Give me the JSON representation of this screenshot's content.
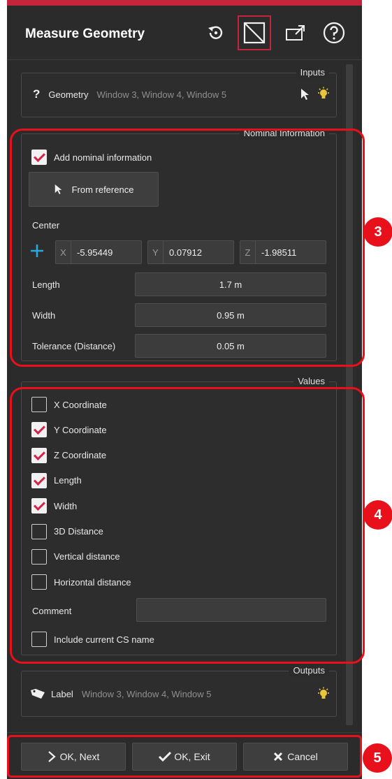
{
  "header": {
    "title": "Measure Geometry"
  },
  "inputs": {
    "group_title": "Inputs",
    "status_glyph": "?",
    "label": "Geometry",
    "value": "Window 3, Window 4, Window 5"
  },
  "nominal": {
    "group_title": "Nominal Information",
    "add_label": "Add nominal information",
    "add_checked": true,
    "from_reference": "From reference",
    "center_label": "Center",
    "x_axis": "X",
    "x_value": "-5.95449",
    "y_axis": "Y",
    "y_value": "0.07912",
    "z_axis": "Z",
    "z_value": "-1.98511",
    "length_label": "Length",
    "length_value": "1.7 m",
    "width_label": "Width",
    "width_value": "0.95 m",
    "tolerance_label": "Tolerance (Distance)",
    "tolerance_value": "0.05 m"
  },
  "values": {
    "group_title": "Values",
    "items": [
      {
        "label": "X Coordinate",
        "checked": false
      },
      {
        "label": "Y Coordinate",
        "checked": true
      },
      {
        "label": "Z Coordinate",
        "checked": true
      },
      {
        "label": "Length",
        "checked": true
      },
      {
        "label": "Width",
        "checked": true
      },
      {
        "label": "3D Distance",
        "checked": false
      },
      {
        "label": "Vertical distance",
        "checked": false
      },
      {
        "label": "Horizontal distance",
        "checked": false
      }
    ],
    "comment_label": "Comment",
    "comment_value": "",
    "include_cs_label": "Include current CS name",
    "include_cs_checked": false
  },
  "outputs": {
    "group_title": "Outputs",
    "label": "Label",
    "value": "Window 3, Window 4, Window 5"
  },
  "footer": {
    "ok_next": "OK, Next",
    "ok_exit": "OK, Exit",
    "cancel": "Cancel"
  },
  "annotations": {
    "badge3": "3",
    "badge4": "4",
    "badge5": "5"
  },
  "colors": {
    "accent": "#c4253c",
    "annotation_red": "#e8101b",
    "panel_bg": "#2b2b2b",
    "center_cross": "#29a8e0",
    "bulb": "#e8c53a"
  }
}
